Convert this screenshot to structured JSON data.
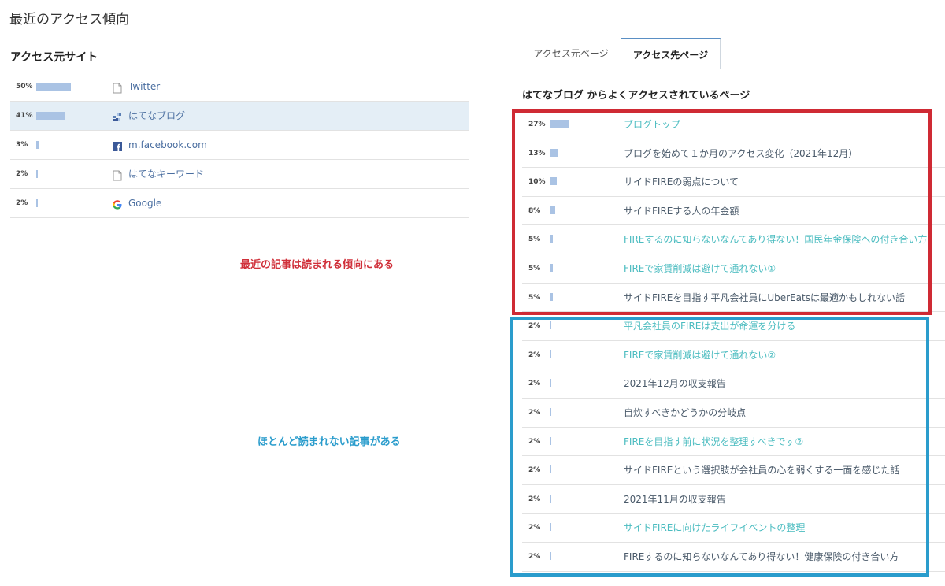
{
  "page_title": "最近のアクセス傾向",
  "sources": {
    "heading": "アクセス元サイト",
    "rows": [
      {
        "pct": "50%",
        "share": 50,
        "label": "Twitter",
        "icon": "document-icon"
      },
      {
        "pct": "41%",
        "share": 41,
        "label": "はてなブログ",
        "icon": "hatena-blog-icon"
      },
      {
        "pct": "3%",
        "share": 3,
        "label": "m.facebook.com",
        "icon": "facebook-icon"
      },
      {
        "pct": "2%",
        "share": 2,
        "label": "はてなキーワード",
        "icon": "document-icon"
      },
      {
        "pct": "2%",
        "share": 2,
        "label": "Google",
        "icon": "google-icon"
      }
    ]
  },
  "tabs": [
    {
      "label": "アクセス元ページ",
      "active": false
    },
    {
      "label": "アクセス先ページ",
      "active": true
    }
  ],
  "destinations": {
    "heading": "はてなブログ からよくアクセスされているページ",
    "rows": [
      {
        "pct": "27%",
        "share": 27,
        "title": "ブログトップ",
        "teal": true
      },
      {
        "pct": "13%",
        "share": 13,
        "title": "ブログを始めて１か月のアクセス変化（2021年12月）",
        "teal": false
      },
      {
        "pct": "10%",
        "share": 10,
        "title": "サイドFIREの弱点について",
        "teal": false
      },
      {
        "pct": "8%",
        "share": 8,
        "title": "サイドFIREする人の年金額",
        "teal": false
      },
      {
        "pct": "5%",
        "share": 5,
        "title": "FIREするのに知らないなんてあり得ない！国民年金保険への付き合い方",
        "teal": true
      },
      {
        "pct": "5%",
        "share": 5,
        "title": "FIREで家賃削減は避けて通れない①",
        "teal": true
      },
      {
        "pct": "5%",
        "share": 5,
        "title": "サイドFIREを目指す平凡会社員にUberEatsは最適かもしれない話",
        "teal": false
      },
      {
        "pct": "2%",
        "share": 2,
        "title": "平凡会社員のFIREは支出が命運を分ける",
        "teal": true
      },
      {
        "pct": "2%",
        "share": 2,
        "title": "FIREで家賃削減は避けて通れない②",
        "teal": true
      },
      {
        "pct": "2%",
        "share": 2,
        "title": "2021年12月の収支報告",
        "teal": false
      },
      {
        "pct": "2%",
        "share": 2,
        "title": "自炊すべきかどうかの分岐点",
        "teal": false
      },
      {
        "pct": "2%",
        "share": 2,
        "title": "FIREを目指す前に状況を整理すべきです②",
        "teal": true
      },
      {
        "pct": "2%",
        "share": 2,
        "title": "サイドFIREという選択肢が会社員の心を弱くする一面を感じた話",
        "teal": false
      },
      {
        "pct": "2%",
        "share": 2,
        "title": "2021年11月の収支報告",
        "teal": false
      },
      {
        "pct": "2%",
        "share": 2,
        "title": "サイドFIREに向けたライフイベントの整理",
        "teal": true
      },
      {
        "pct": "2%",
        "share": 2,
        "title": "FIREするのに知らないなんてあり得ない！健康保険の付き合い方",
        "teal": false
      }
    ]
  },
  "annotations": {
    "red_note": "最近の記事は読まれる傾向にある",
    "blue_note": "ほとんど読まれない記事がある"
  },
  "colors": {
    "bar": "#aac3e4",
    "highlight_row": "#e4eef6",
    "teal_link": "#4bbcc0",
    "annotation_red": "#cf2a34",
    "annotation_blue": "#2a9ccc"
  }
}
